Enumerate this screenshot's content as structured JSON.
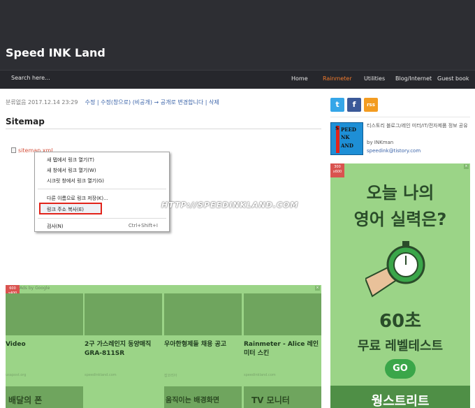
{
  "header": {
    "site_title": "Speed INK Land",
    "search_label": "Search here...",
    "nav": [
      "Home",
      "Rainmeter",
      "Utilities",
      "Blog/Internet",
      "Guest book"
    ]
  },
  "post": {
    "category": "분류없음",
    "date": "2017.12.14 23:29",
    "edit": "수정",
    "edit_window": "| 수정(창으로)",
    "visibility": "(비공개) → 공개로 변경합니다",
    "delete": "| 삭제",
    "title": "Sitemap",
    "file_link": "sitemap.xml"
  },
  "context_menu": {
    "items": [
      "새 탭에서 링크 열기(T)",
      "새 창에서 링크 열기(W)",
      "시크릿 창에서 링크 열기(G)",
      "다른 이름으로 링크 저장(K)...",
      "링크 주소 복사(E)",
      "검사(N)"
    ],
    "shortcut": "Ctrl+Shift+I",
    "highlighted_item": "링크 주소 복사(E)"
  },
  "watermark": "HTTP://SPEEDINKLAND.COM",
  "bottom_ad": {
    "badge": "600\nx400",
    "ads_by": "Ads by Google",
    "tiles": [
      {
        "title": "Video",
        "source": "usapost.org"
      },
      {
        "title": "2구 가스레인지 동양매직 GRA-811SR",
        "source": "speedinkland.com"
      },
      {
        "title": "우아한형제들 채용 공고",
        "source": "잡코리아"
      },
      {
        "title": "Rainmeter - Alice 레인미터 스킨",
        "source": "speedinkland.com"
      }
    ],
    "second_row": [
      "배달의 폰",
      "움직이는 배경화면",
      "TV 모니터"
    ]
  },
  "sidebar": {
    "social": [
      "t",
      "f",
      "rss"
    ],
    "profile_desc": "티스토리 블로그/레인 미터/IT/전자제품 정보 공유",
    "profile_by": "by INKman",
    "profile_email": "speedink@tistory.com",
    "ad": {
      "badge": "300\nx600",
      "headline1": "오늘 나의",
      "headline2": "영어 실력은?",
      "seconds": "60초",
      "free_test": "무료 레벨테스트",
      "go": "GO",
      "brand": "웡스트리트"
    }
  },
  "colors": {
    "header_bg": "#2d2e33",
    "nav_active": "#f07a2c",
    "ad_green": "#9bd487",
    "highlight_red": "#e2231a"
  }
}
